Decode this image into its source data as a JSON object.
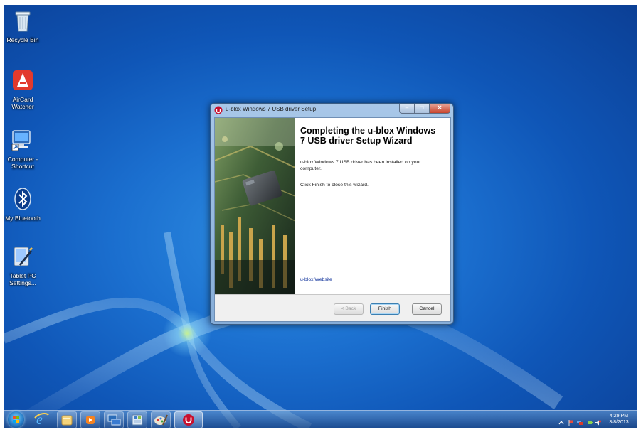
{
  "desktop": {
    "icons": [
      {
        "label": "Recycle Bin",
        "icon": "recycle-bin-icon"
      },
      {
        "label": "AirCard Watcher",
        "icon": "aircard-watcher-icon"
      },
      {
        "label": "Computer - Shortcut",
        "icon": "computer-shortcut-icon"
      },
      {
        "label": "My Bluetooth",
        "icon": "bluetooth-icon"
      },
      {
        "label": "Tablet PC Settings...",
        "icon": "tablet-pc-settings-icon"
      }
    ]
  },
  "window": {
    "title": "u-blox Windows 7 USB driver Setup",
    "heading": "Completing the u-blox Windows 7 USB driver Setup Wizard",
    "message": "u-blox Windows 7 USB driver has been installed on your computer.",
    "instruction": "Click Finish to close this wizard.",
    "link": "u-blox Website",
    "buttons": {
      "back": "< Back",
      "finish": "Finish",
      "cancel": "Cancel"
    }
  },
  "taskbar": {
    "pinned": [
      "internet-explorer-icon",
      "file-explorer-icon",
      "media-player-icon",
      "network-icon",
      "control-panel-icon",
      "paint-icon",
      "u-blox-setup-icon"
    ],
    "clock": {
      "time": "4:29 PM",
      "date": "3/8/2013"
    }
  },
  "colors": {
    "desktop_blue": "#1b6fcf",
    "taskbar_blue": "#1e4682",
    "link_blue": "#0b2e99",
    "u_blox_red": "#c8102e"
  }
}
